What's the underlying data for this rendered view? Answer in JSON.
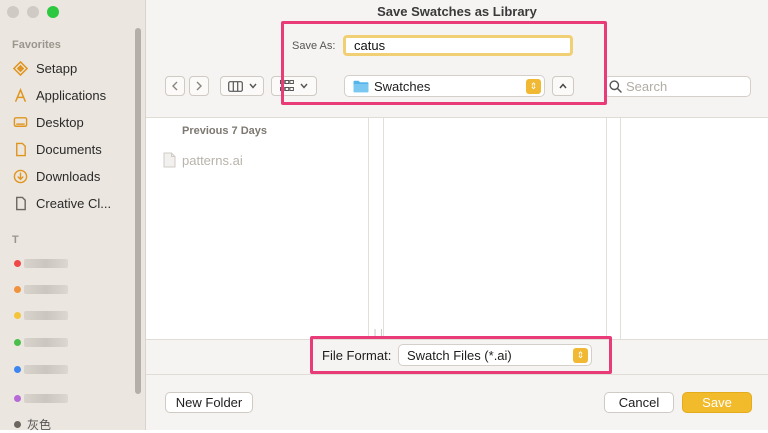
{
  "window": {
    "title": "Save Swatches as Library"
  },
  "sidebar": {
    "favorites_label": "Favorites",
    "items": [
      {
        "label": "Setapp",
        "icon": "setapp-icon"
      },
      {
        "label": "Applications",
        "icon": "applications-icon"
      },
      {
        "label": "Desktop",
        "icon": "desktop-icon"
      },
      {
        "label": "Documents",
        "icon": "document-icon"
      },
      {
        "label": "Downloads",
        "icon": "download-icon"
      },
      {
        "label": "Creative Cl...",
        "icon": "file-icon"
      }
    ],
    "tags_label": "T",
    "tag_colors": [
      "#f04848",
      "#f0913c",
      "#f2c53b",
      "#49c04b",
      "#3b86f0",
      "#b66ad8"
    ],
    "bottom_item_label": "灰色"
  },
  "save_as": {
    "label": "Save As:",
    "value": "catus"
  },
  "toolbar": {
    "location": "Swatches",
    "search_placeholder": "Search"
  },
  "browser": {
    "section_header": "Previous 7 Days",
    "files": [
      {
        "name": "patterns.ai"
      }
    ]
  },
  "format": {
    "label": "File Format:",
    "value": "Swatch Files (*.ai)"
  },
  "buttons": {
    "new_folder": "New Folder",
    "cancel": "Cancel",
    "save": "Save"
  },
  "colors": {
    "accent": "#f2bb2b",
    "highlight": "#ea3b79",
    "sidebar_bg": "#ebe6df"
  }
}
